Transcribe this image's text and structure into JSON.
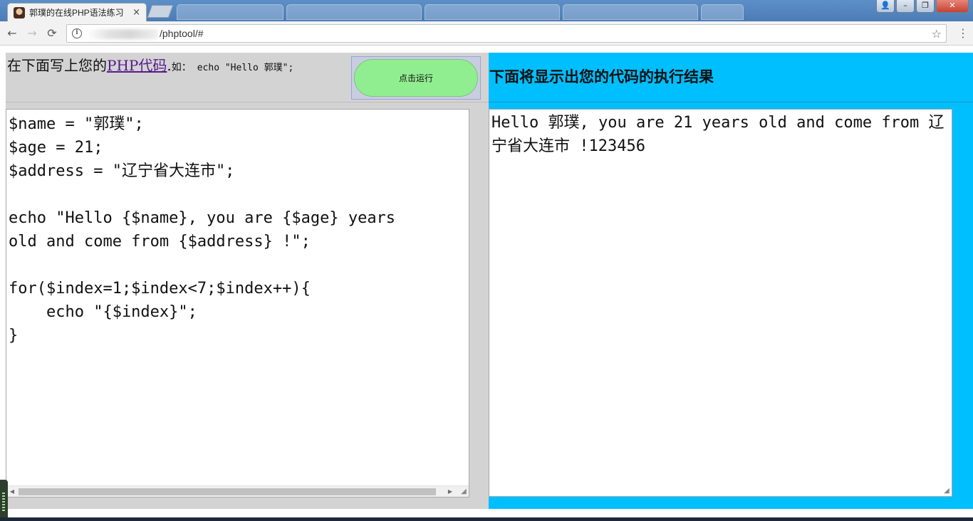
{
  "browser": {
    "active_tab_title": "郭璞的在线PHP语法练习",
    "tab_close_glyph": "×",
    "url": "/phptool/#",
    "window_controls": {
      "user": "👤",
      "minimize": "–",
      "maximize": "❐",
      "close": "✕"
    },
    "nav": {
      "back": "←",
      "forward": "→",
      "reload": "⟳",
      "info": "i",
      "star": "☆",
      "menu": "⋮"
    }
  },
  "left": {
    "instruction_text": "在下面写上您的",
    "instruction_link": "PHP代码",
    "instruction_period": ".",
    "example_label": "如：",
    "example_code": "echo \"Hello 郭璞\";",
    "run_button_label": "点击运行",
    "code": "$name = \"郭璞\";\n$age = 21;\n$address = \"辽宁省大连市\";\n\necho \"Hello {$name}, you are {$age} years\nold and come from {$address} !\";\n\nfor($index=1;$index<7;$index++){\n    echo \"{$index}\";\n}",
    "scroll_left_glyph": "◀",
    "scroll_right_glyph": "▶",
    "resize_glyph": "◢"
  },
  "right": {
    "title": "下面将显示出您的代码的执行结果",
    "output": "Hello 郭璞, you are 21 years old and come from 辽宁省大连市 !123456",
    "resize_glyph": "◢"
  },
  "colors": {
    "left_panel_bg": "#d3d3d3",
    "right_panel_bg": "#00bfff",
    "run_button_bg": "#90ee90",
    "link_color": "#551a8b"
  }
}
